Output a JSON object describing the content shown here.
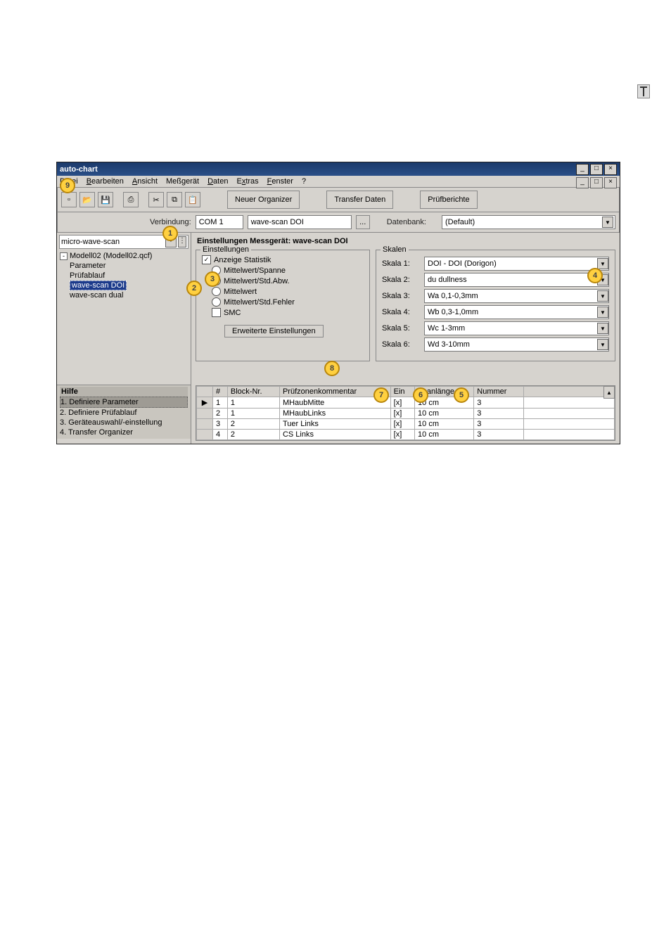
{
  "window": {
    "title": "auto-chart",
    "min": "_",
    "max": "□",
    "close": "×",
    "mdi_min": "_",
    "mdi_max": "□",
    "mdi_close": "×"
  },
  "menu": {
    "file": "Datei",
    "edit": "Bearbeiten",
    "view": "Ansicht",
    "device": "Meßgerät",
    "data": "Daten",
    "extras": "Extras",
    "window": "Fenster",
    "help": "?"
  },
  "toolbar": {
    "new": "□",
    "open": "▢",
    "save": "▣",
    "print": "⎙",
    "cut": "✂",
    "copy": "⧉",
    "paste": "📋",
    "neworg": "Neuer Organizer",
    "transfer": "Transfer Daten",
    "reports": "Prüfberichte"
  },
  "row2": {
    "verbindung": "Verbindung:",
    "com": "COM 1",
    "device": "wave-scan DOI",
    "dots": "...",
    "datenbank": "Datenbank:",
    "db": "(Default)"
  },
  "tree": {
    "hdr": "micro-wave-scan",
    "root": "Modell02 (Modell02.qcf)",
    "param": "Parameter",
    "flow": "Prüfablauf",
    "dev1": "wave-scan DOI",
    "dev2": "wave-scan dual"
  },
  "help": {
    "title": "Hilfe",
    "h1": "1. Definiere Parameter",
    "h2": "2. Definiere Prüfablauf",
    "h3": "3. Geräteauswahl/-einstellung",
    "h4": "4. Transfer Organizer"
  },
  "panel": {
    "title": "Einstellungen Messgerät: wave-scan DOI",
    "grpEinst": "Einstellungen",
    "chkStat": "Anzeige Statistik",
    "r1": "Mittelwert/Spanne",
    "r2": "Mittelwert/Std.Abw.",
    "r3": "Mittelwert",
    "r4": "Mittelwert/Std.Fehler",
    "cSMC": "SMC",
    "grpSkalen": "Skalen",
    "s1l": "Skala 1:",
    "s1v": "DOI - DOI (Dorigon)",
    "s2l": "Skala 2:",
    "s2v": "du dullness",
    "s3l": "Skala 3:",
    "s3v": "Wa 0,1-0,3mm",
    "s4l": "Skala 4:",
    "s4v": "Wb 0,3-1,0mm",
    "s5l": "Skala 5:",
    "s5v": "Wc 1-3mm",
    "s6l": "Skala 6:",
    "s6v": "Wd 3-10mm",
    "adv": "Erweiterte Einstellungen"
  },
  "table": {
    "h_hash": "#",
    "h_block": "Block-Nr.",
    "h_komm": "Prüfzonenkommentar",
    "h_ein": "Ein",
    "h_scan": "Scanlänge",
    "h_num": "Nummer",
    "rows": [
      {
        "n": "1",
        "b": "1",
        "k": "MHaubMitte",
        "e": "[x]",
        "s": "10 cm",
        "m": "3"
      },
      {
        "n": "2",
        "b": "1",
        "k": "MHaubLinks",
        "e": "[x]",
        "s": "10 cm",
        "m": "3"
      },
      {
        "n": "3",
        "b": "2",
        "k": "Tuer Links",
        "e": "[x]",
        "s": "10 cm",
        "m": "3"
      },
      {
        "n": "4",
        "b": "2",
        "k": "CS Links",
        "e": "[x]",
        "s": "10 cm",
        "m": "3"
      }
    ]
  },
  "bubbles": {
    "b1": "1",
    "b2": "2",
    "b3": "3",
    "b4": "4",
    "b5": "5",
    "b6": "6",
    "b7": "7",
    "b8": "8",
    "b9": "9"
  }
}
